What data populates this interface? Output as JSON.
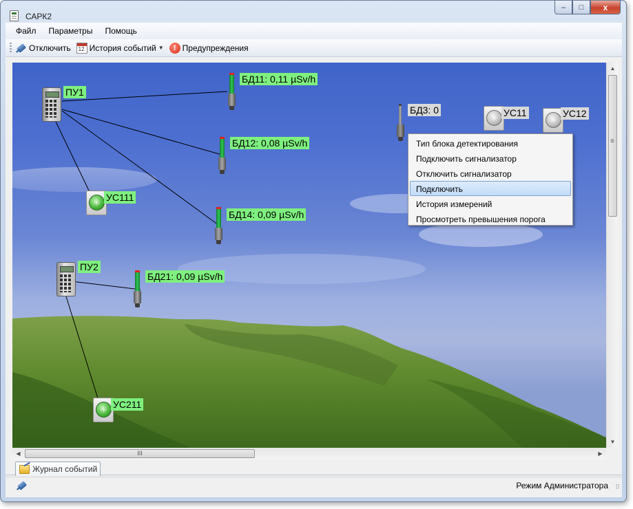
{
  "window": {
    "title": "САРК2",
    "controls": {
      "minimize": "–",
      "maximize": "□",
      "close": "x"
    }
  },
  "menu": [
    "Файл",
    "Параметры",
    "Помощь"
  ],
  "toolbar": {
    "disconnect_label": "Отключить",
    "event_history_label": "История событий",
    "warnings_label": "Предупреждения",
    "icons": [
      "plug-icon",
      "calendar-icon",
      "chevron-down-icon",
      "warning-icon"
    ]
  },
  "map": {
    "controllers": [
      {
        "label": "ПУ1"
      },
      {
        "label": "ПУ2"
      }
    ],
    "detectors": [
      {
        "label": "БД11: 0,11 µSv/h",
        "connected": true
      },
      {
        "label": "БД12: 0,08 µSv/h",
        "connected": true
      },
      {
        "label": "БД14: 0,09 µSv/h",
        "connected": true
      },
      {
        "label": "БД21: 0,09 µSv/h",
        "connected": true
      },
      {
        "label": "БД3: 0",
        "connected": false
      }
    ],
    "alarms": [
      {
        "label": "УС111",
        "connected": true
      },
      {
        "label": "УС211",
        "connected": true
      },
      {
        "label": "УС11",
        "connected": false
      },
      {
        "label": "УС12",
        "connected": false
      }
    ],
    "colors": {
      "connected_label": "#7ff07f",
      "disconnected_label": "#d9d9d9"
    }
  },
  "context_menu": {
    "items": [
      "Тип блока детектирования",
      "Подключить сигнализатор",
      "Отключить сигнализатор",
      "Подключить",
      "История измерений",
      "Просмотреть превышения порога"
    ],
    "highlighted": "Подключить"
  },
  "scrollbars": {
    "thumb_grip": "III"
  },
  "tabs": [
    {
      "label": "Журнал событий"
    }
  ],
  "status": {
    "mode": "Режим Администратора"
  }
}
